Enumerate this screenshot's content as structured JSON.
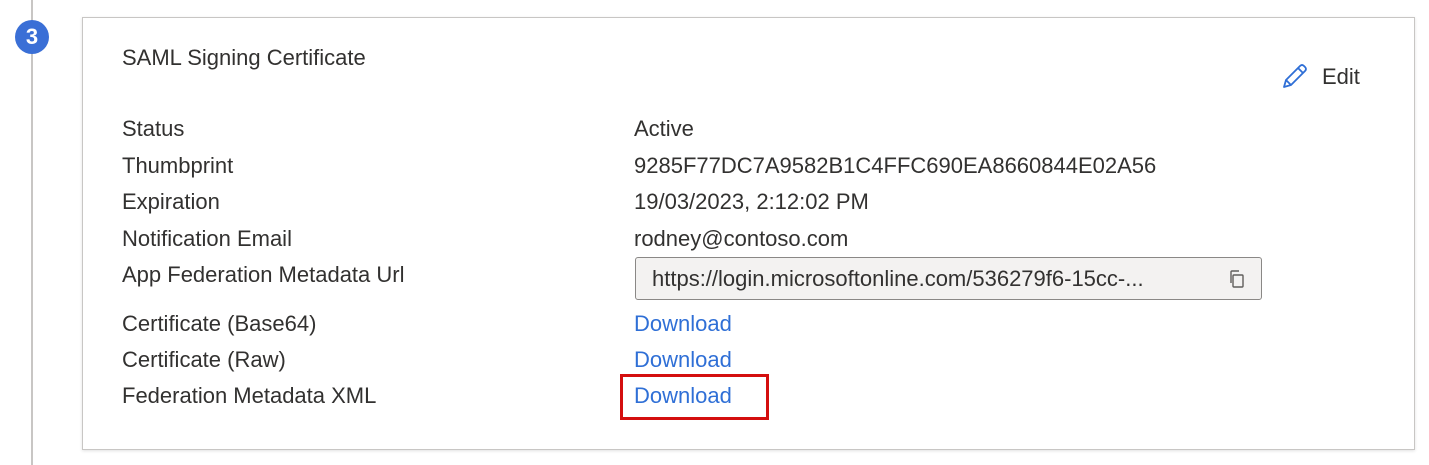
{
  "step": {
    "number": "3"
  },
  "card": {
    "title": "SAML Signing Certificate",
    "edit_label": "Edit"
  },
  "fields": {
    "status": {
      "label": "Status",
      "value": "Active"
    },
    "thumbprint": {
      "label": "Thumbprint",
      "value": "9285F77DC7A9582B1C4FFC690EA8660844E02A56"
    },
    "expiration": {
      "label": "Expiration",
      "value": "19/03/2023, 2:12:02 PM"
    },
    "notification_email": {
      "label": "Notification Email",
      "value": "rodney@contoso.com"
    },
    "metadata_url": {
      "label": "App Federation Metadata Url",
      "value": "https://login.microsoftonline.com/536279f6-15cc-..."
    },
    "cert_base64": {
      "label": "Certificate (Base64)",
      "link": "Download"
    },
    "cert_raw": {
      "label": "Certificate (Raw)",
      "link": "Download"
    },
    "federation_xml": {
      "label": "Federation Metadata XML",
      "link": "Download"
    }
  },
  "icons": {
    "edit": "pencil-icon",
    "copy": "copy-icon"
  },
  "colors": {
    "step_badge": "#3a6fd6",
    "link": "#2f6fd6",
    "highlight": "#d40e0e",
    "url_box_bg": "#f3f2f1"
  }
}
